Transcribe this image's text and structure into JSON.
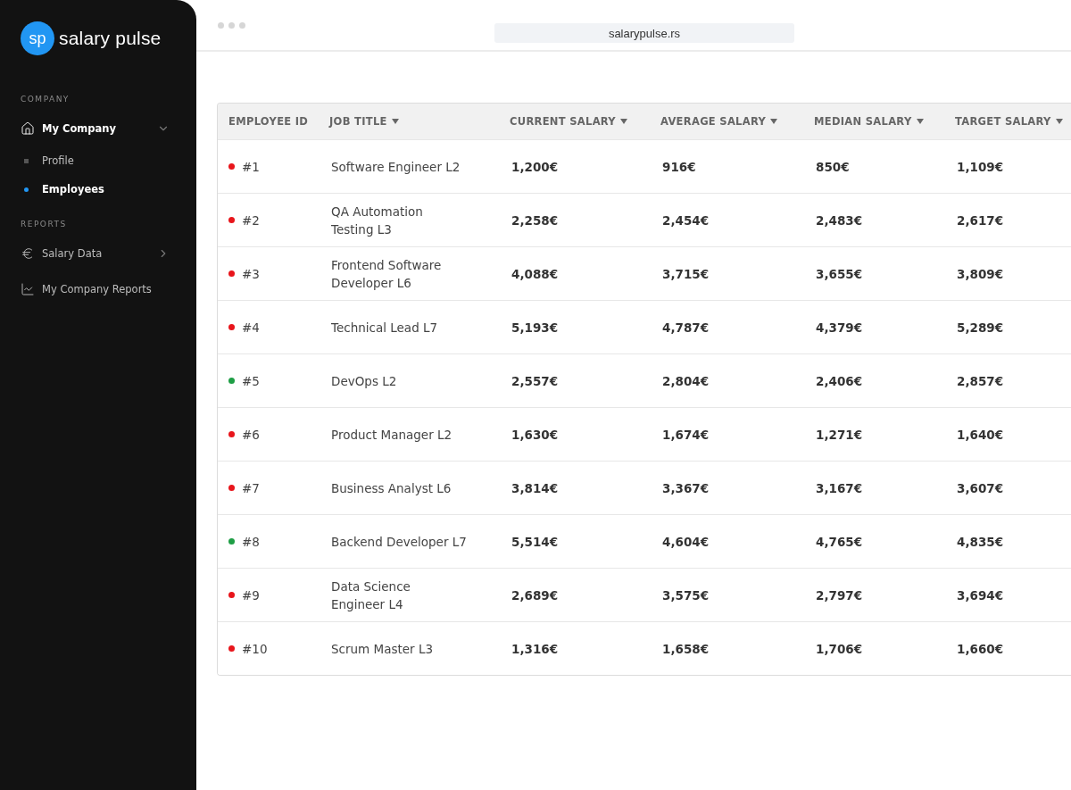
{
  "sidebar": {
    "logo": {
      "mark": "sp",
      "name": "salary pulse"
    },
    "sections": [
      {
        "heading": "COMPANY",
        "items": [
          {
            "label": "My Company",
            "kind": "home",
            "selected": true,
            "expanded": true,
            "children": [
              {
                "label": "Profile",
                "selected": false
              },
              {
                "label": "Employees",
                "selected": true
              }
            ]
          }
        ]
      },
      {
        "heading": "REPORTS",
        "items": [
          {
            "label": "Salary Data",
            "kind": "currency",
            "selected": false,
            "expanded": false
          },
          {
            "label": "My Company Reports",
            "kind": "report",
            "selected": false
          }
        ]
      }
    ]
  },
  "browser": {
    "url": "salarypulse.rs"
  },
  "table": {
    "columns": [
      {
        "label": "EMPLOYEE ID",
        "sortable": false
      },
      {
        "label": "JOB TITLE",
        "sortable": true
      },
      {
        "label": "CURRENT SALARY",
        "sortable": true
      },
      {
        "label": "AVERAGE SALARY",
        "sortable": true
      },
      {
        "label": "MEDIAN SALARY",
        "sortable": true
      },
      {
        "label": "TARGET SALARY",
        "sortable": true
      }
    ],
    "rows": [
      {
        "id": "#1",
        "color": "#e8151b",
        "title": [
          "Software Engineer L2"
        ],
        "current": "1,200€",
        "average": "916€",
        "median": "850€",
        "target": "1,109€"
      },
      {
        "id": "#2",
        "color": "#e8151b",
        "title": [
          "QA Automation",
          "Testing L3"
        ],
        "current": "2,258€",
        "average": "2,454€",
        "median": "2,483€",
        "target": "2,617€"
      },
      {
        "id": "#3",
        "color": "#e8151b",
        "title": [
          "Frontend Software",
          "Developer L6"
        ],
        "current": "4,088€",
        "average": "3,715€",
        "median": "3,655€",
        "target": "3,809€"
      },
      {
        "id": "#4",
        "color": "#e8151b",
        "title": [
          "Technical Lead L7"
        ],
        "current": "5,193€",
        "average": "4,787€",
        "median": "4,379€",
        "target": "5,289€"
      },
      {
        "id": "#5",
        "color": "#1e9e45",
        "title": [
          "DevOps L2"
        ],
        "current": "2,557€",
        "average": "2,804€",
        "median": "2,406€",
        "target": "2,857€"
      },
      {
        "id": "#6",
        "color": "#e8151b",
        "title": [
          "Product Manager L2"
        ],
        "current": "1,630€",
        "average": "1,674€",
        "median": "1,271€",
        "target": "1,640€"
      },
      {
        "id": "#7",
        "color": "#e8151b",
        "title": [
          "Business Analyst L6"
        ],
        "current": "3,814€",
        "average": "3,367€",
        "median": "3,167€",
        "target": "3,607€"
      },
      {
        "id": "#8",
        "color": "#1e9e45",
        "title": [
          "Backend Developer L7"
        ],
        "current": "5,514€",
        "average": "4,604€",
        "median": "4,765€",
        "target": "4,835€"
      },
      {
        "id": "#9",
        "color": "#e8151b",
        "title": [
          "Data Science",
          "Engineer L4"
        ],
        "current": "2,689€",
        "average": "3,575€",
        "median": "2,797€",
        "target": "3,694€"
      },
      {
        "id": "#10",
        "color": "#e8151b",
        "title": [
          "Scrum Master L3"
        ],
        "current": "1,316€",
        "average": "1,658€",
        "median": "1,706€",
        "target": "1,660€"
      }
    ]
  }
}
